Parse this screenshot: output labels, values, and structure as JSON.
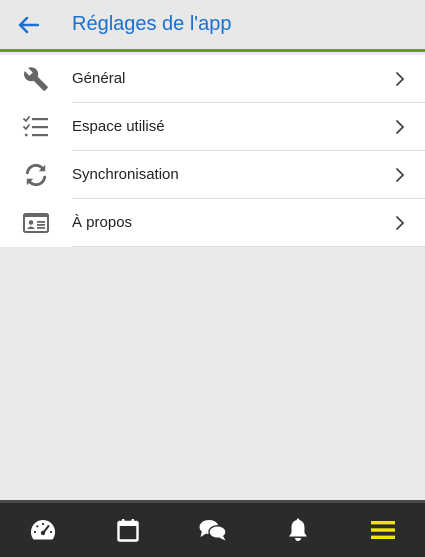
{
  "header": {
    "back_icon": "arrow-left-icon",
    "title": "Réglages de l'app"
  },
  "colors": {
    "title": "#1a6fd1",
    "accent_line": "#6b9a1f",
    "active_nav": "#f2e600"
  },
  "settings": {
    "items": [
      {
        "icon": "wrench-icon",
        "label": "Général"
      },
      {
        "icon": "checklist-icon",
        "label": "Espace utilisé"
      },
      {
        "icon": "sync-icon",
        "label": "Synchronisation"
      },
      {
        "icon": "id-card-icon",
        "label": "À propos"
      }
    ]
  },
  "bottom_nav": {
    "items": [
      {
        "icon": "dashboard-icon"
      },
      {
        "icon": "calendar-icon"
      },
      {
        "icon": "chat-icon"
      },
      {
        "icon": "bell-icon"
      },
      {
        "icon": "menu-icon",
        "active": true
      }
    ]
  }
}
